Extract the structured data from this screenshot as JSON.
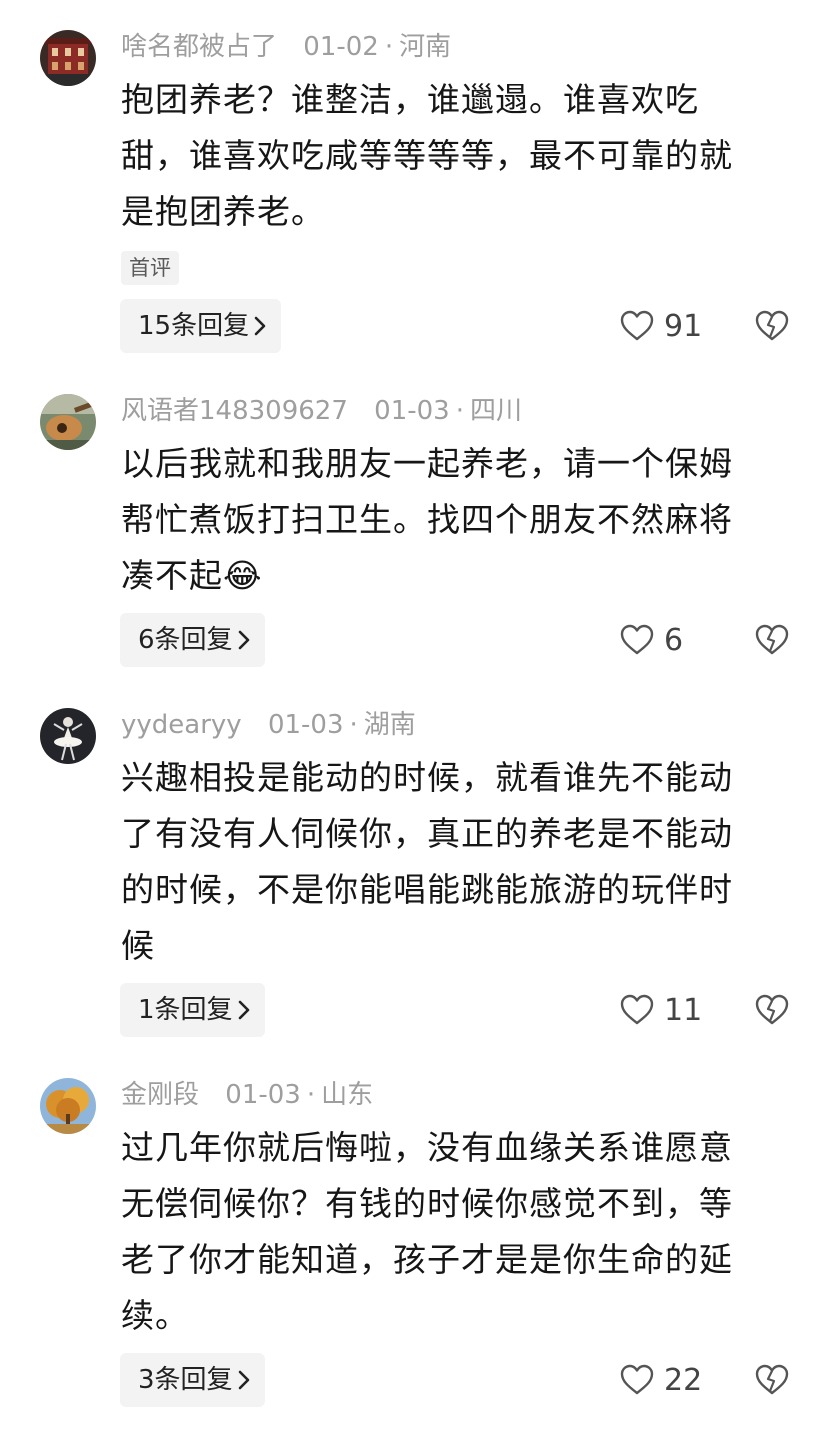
{
  "comments": [
    {
      "username": "啥名都被占了",
      "date": "01-02",
      "location": "河南",
      "lines": [
        "抱团养老？谁整洁，谁邋遢。谁喜欢吃",
        "甜，谁喜欢吃咸等等等等，最不可靠的就",
        "是抱团养老。"
      ],
      "tag": "首评",
      "replies": "15条回复",
      "likes": "91",
      "avatar": "building-avatar"
    },
    {
      "username": "风语者148309627",
      "date": "01-03",
      "location": "四川",
      "lines": [
        "以后我就和我朋友一起养老，请一个保姆",
        "帮忙煮饭打扫卫生。找四个朋友不然麻将",
        "凑不起😂"
      ],
      "replies": "6条回复",
      "likes": "6",
      "avatar": "guitar-avatar"
    },
    {
      "username": "yydearyy",
      "date": "01-03",
      "location": "湖南",
      "lines": [
        "兴趣相投是能动的时候，就看谁先不能动",
        "了有没有人伺候你，真正的养老是不能动",
        "的时候，不是你能唱能跳能旅游的玩伴时",
        "候"
      ],
      "replies": "1条回复",
      "likes": "11",
      "avatar": "ballerina-avatar"
    },
    {
      "username": "金刚段",
      "date": "01-03",
      "location": "山东",
      "lines": [
        "过几年你就后悔啦，没有血缘关系谁愿意",
        "无偿伺候你？有钱的时候你感觉不到，等",
        "老了你才能知道，孩子才是是你生命的延",
        "续。"
      ],
      "replies": "3条回复",
      "likes": "22",
      "avatar": "autumn-tree-avatar"
    }
  ],
  "icons": {
    "like": "heart-outline-icon",
    "dislike": "broken-heart-icon",
    "chevron": "chevron-right-icon"
  }
}
